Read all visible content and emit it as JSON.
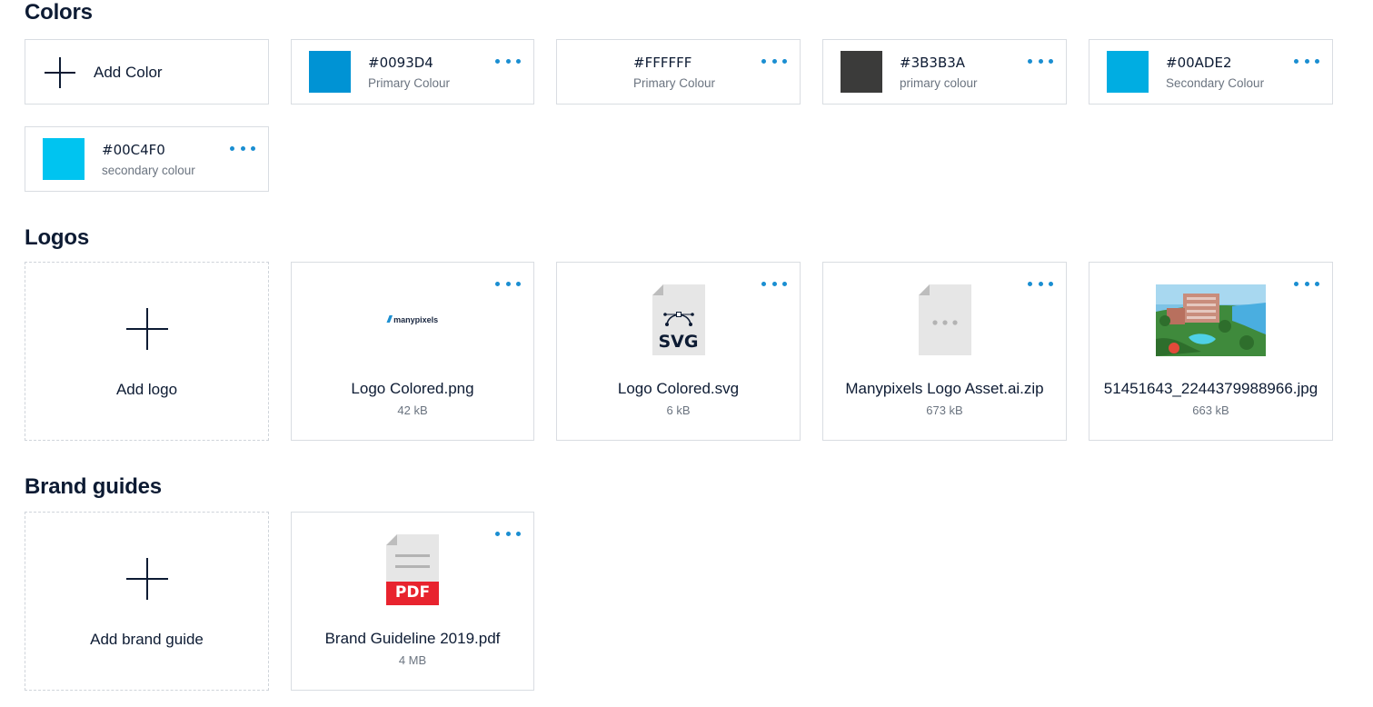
{
  "sections": {
    "colors": "Colors",
    "logos": "Logos",
    "brand_guides": "Brand guides"
  },
  "colors": {
    "add_label": "Add Color",
    "items": [
      {
        "hex": "#0093D4",
        "label": "Primary Colour",
        "swatch": "#0093D4"
      },
      {
        "hex": "#FFFFFF",
        "label": "Primary Colour",
        "swatch": "#FFFFFF"
      },
      {
        "hex": "#3B3B3A",
        "label": "primary colour",
        "swatch": "#3B3B3A"
      },
      {
        "hex": "#00ADE2",
        "label": "Secondary Colour",
        "swatch": "#00ADE2"
      },
      {
        "hex": "#00C4F0",
        "label": "secondary colour",
        "swatch": "#00C4F0"
      }
    ]
  },
  "logos": {
    "add_label": "Add logo",
    "items": [
      {
        "name": "Logo Colored.png",
        "size": "42 kB",
        "thumb": "manypixels-logo",
        "logo_text": "manypixels"
      },
      {
        "name": "Logo Colored.svg",
        "size": "6 kB",
        "thumb": "svg-file-icon",
        "icon_text": "SVG"
      },
      {
        "name": "Manypixels Logo Asset.ai.zip",
        "size": "673 kB",
        "thumb": "generic-file-icon"
      },
      {
        "name": "51451643_2244379988966.jpg",
        "size": "663 kB",
        "thumb": "photo-thumbnail"
      }
    ]
  },
  "brand_guides": {
    "add_label": "Add brand guide",
    "items": [
      {
        "name": "Brand Guideline 2019.pdf",
        "size": "4 MB",
        "thumb": "pdf-file-icon",
        "icon_text": "PDF"
      }
    ]
  },
  "theme": {
    "accent": "#1A8ED1",
    "text": "#0D1B33",
    "muted": "#6B7480",
    "border": "#D9DDE2",
    "pdf_red": "#E8232E"
  }
}
